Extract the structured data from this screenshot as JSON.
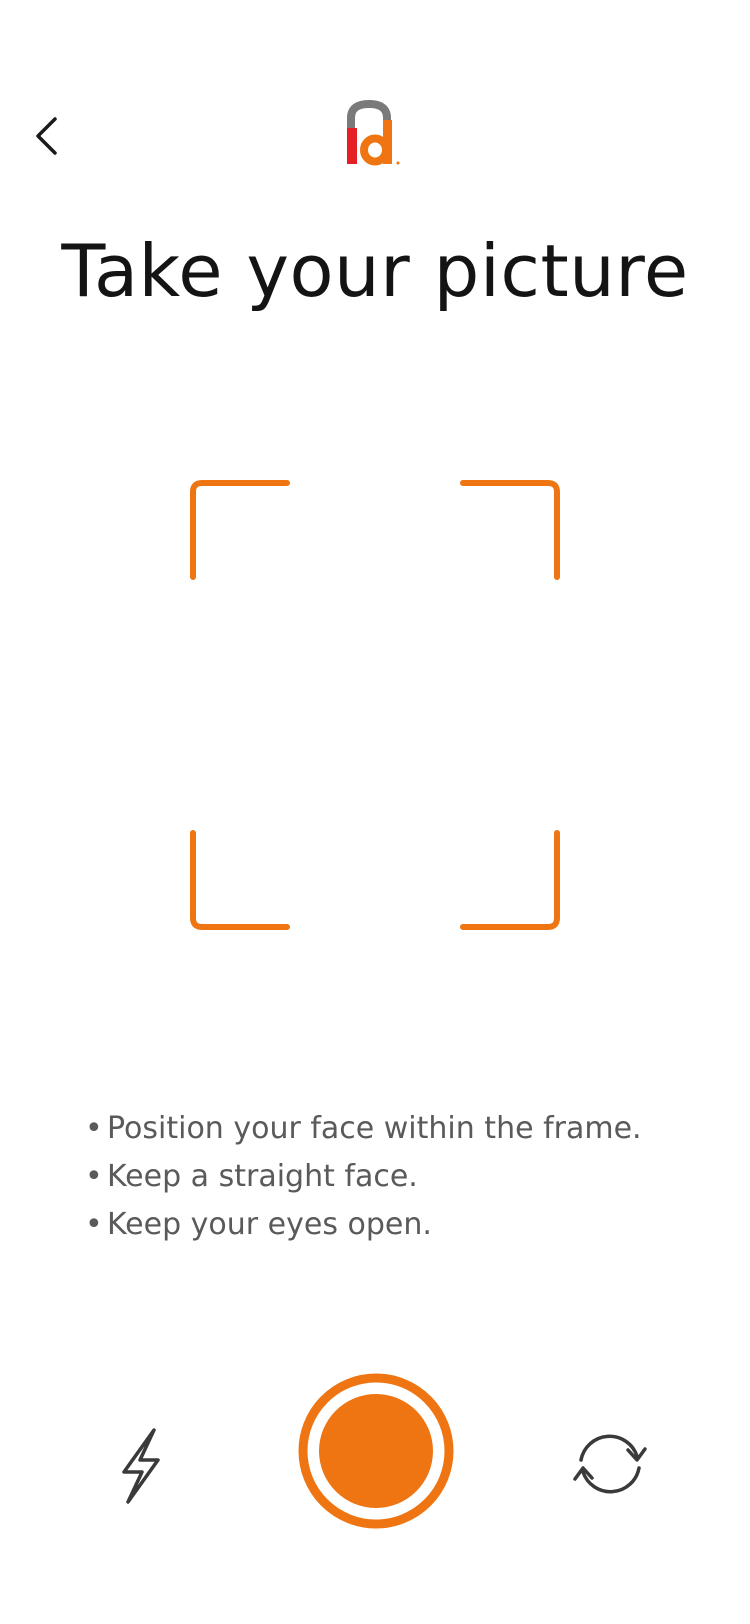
{
  "header": {
    "back_icon": "chevron-left-icon",
    "logo_icon": "id-lock-logo"
  },
  "title": "Take your picture",
  "frame": {
    "icon": "face-frame-corners",
    "color": "#EE7511"
  },
  "instructions": [
    {
      "bullet": "•",
      "text": "Position your face within the frame."
    },
    {
      "bullet": "•",
      "text": "Keep a straight face."
    },
    {
      "bullet": "•",
      "text": "Keep your eyes open."
    }
  ],
  "controls": {
    "flash_icon": "flash-icon",
    "shutter_icon": "shutter-icon",
    "switch_icon": "switch-camera-icon"
  },
  "colors": {
    "accent": "#EE7511",
    "logo_red": "#E41F26",
    "logo_gray": "#7A7A7A",
    "text_dark": "#141414",
    "text_muted": "#5A5A5A"
  }
}
